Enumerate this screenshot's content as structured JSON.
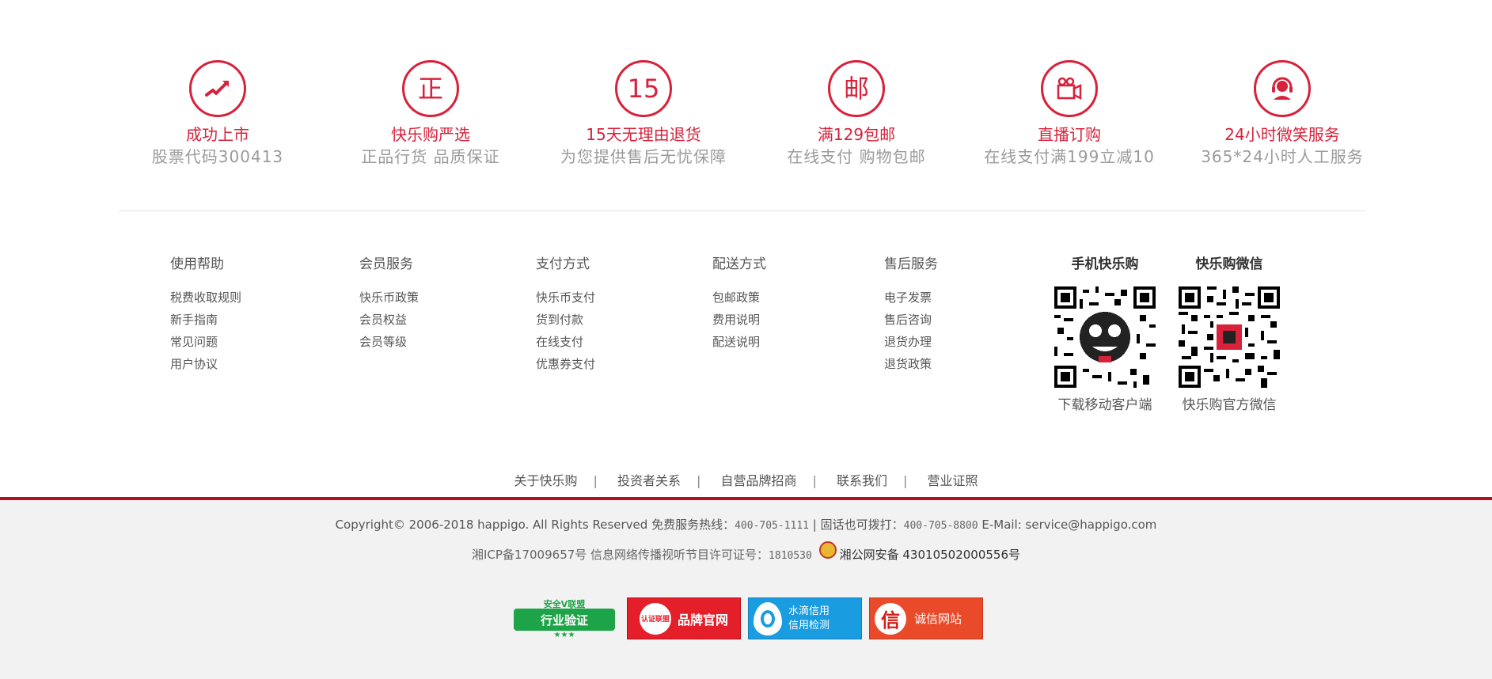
{
  "promises": [
    {
      "icon": "trend-up-icon",
      "glyph": "",
      "title": "成功上市",
      "sub": "股票代码300413"
    },
    {
      "icon": "zheng-icon",
      "glyph": "正",
      "title": "快乐购严选",
      "sub": "正品行货 品质保证"
    },
    {
      "icon": "fifteen-icon",
      "glyph": "15",
      "title": "15天无理由退货",
      "sub": "为您提供售后无忧保障"
    },
    {
      "icon": "mail-icon",
      "glyph": "邮",
      "title": "满129包邮",
      "sub": "在线支付 购物包邮"
    },
    {
      "icon": "video-camera-icon",
      "glyph": "",
      "title": "直播订购",
      "sub": "在线支付满199立减10"
    },
    {
      "icon": "headset-icon",
      "glyph": "",
      "title": "24小时微笑服务",
      "sub": "365*24小时人工服务"
    }
  ],
  "columns": [
    {
      "title": "使用帮助",
      "items": [
        "税费收取规则",
        "新手指南",
        "常见问题",
        "用户协议"
      ]
    },
    {
      "title": "会员服务",
      "items": [
        "快乐币政策",
        "会员权益",
        "会员等级"
      ]
    },
    {
      "title": "支付方式",
      "items": [
        "快乐币支付",
        "货到付款",
        "在线支付",
        "优惠券支付"
      ]
    },
    {
      "title": "配送方式",
      "items": [
        "包邮政策",
        "费用说明",
        "配送说明"
      ]
    },
    {
      "title": "售后服务",
      "items": [
        "电子发票",
        "售后咨询",
        "退货办理",
        "退货政策"
      ]
    }
  ],
  "qr": [
    {
      "title": "手机快乐购",
      "caption": "下载移动客户端"
    },
    {
      "title": "快乐购微信",
      "caption": "快乐购官方微信"
    }
  ],
  "links": [
    "关于快乐购",
    "投资者关系",
    "自营品牌招商",
    "联系我们",
    "营业证照"
  ],
  "separator": "|",
  "copyright": {
    "text1": "Copyright© 2006-2018 happigo. All Rights Reserved 免费服务热线：",
    "hotline": "400-705-1111",
    "sep": "|",
    "text2": "固话也可拨打：",
    "landline": "400-705-8800",
    "email": "E-Mail: service@happigo.com"
  },
  "icp": {
    "text1": "湘ICP备17009657号 信息网络传播视听节目许可证号：",
    "license": "1810530",
    "police": "湘公网安备 43010502000556号"
  },
  "badges": {
    "b1_top": "安全V联盟",
    "b1_main": "行业验证",
    "b1_stars": "★★★",
    "b2_seal": "认证联盟",
    "b2_text": "品牌官网",
    "b3_line1": "水滴信用",
    "b3_line2": "信用检测",
    "b4_icon": "信",
    "b4_text": "诚信网站"
  },
  "colors": {
    "accent": "#d8213a",
    "footer_line": "#b5101e",
    "footer_bg": "#f2f2f2"
  }
}
